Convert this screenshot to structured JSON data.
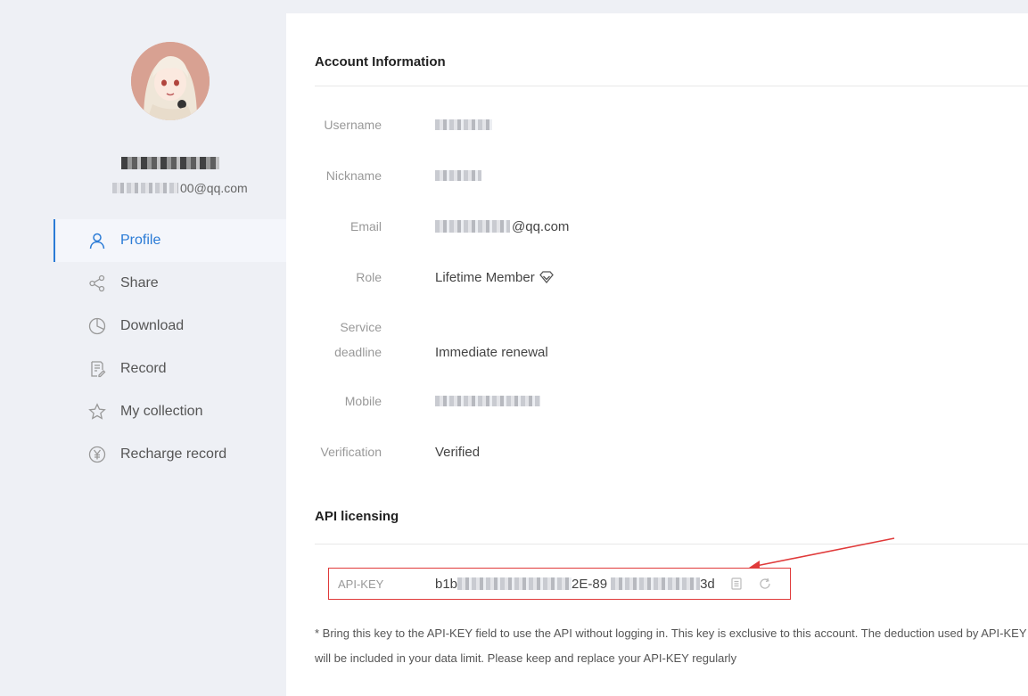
{
  "sidebar": {
    "user_email_suffix": "00@qq.com",
    "nav": [
      {
        "label": "Profile",
        "icon": "user-icon",
        "active": true
      },
      {
        "label": "Share",
        "icon": "share-icon"
      },
      {
        "label": "Download",
        "icon": "pie-chart-icon"
      },
      {
        "label": "Record",
        "icon": "record-icon"
      },
      {
        "label": "My collection",
        "icon": "star-icon"
      },
      {
        "label": "Recharge record",
        "icon": "yen-icon"
      }
    ]
  },
  "account": {
    "title": "Account Information",
    "fields": {
      "username_label": "Username",
      "nickname_label": "Nickname",
      "email_label": "Email",
      "email_suffix": "@qq.com",
      "role_label": "Role",
      "role_value": "Lifetime Member",
      "service_label_1": "Service",
      "service_label_2": "deadline",
      "service_value": "Immediate renewal",
      "mobile_label": "Mobile",
      "verification_label": "Verification",
      "verification_value": "Verified"
    }
  },
  "api": {
    "title": "API licensing",
    "key_label": "API-KEY",
    "key_prefix": "b1b",
    "key_mid": "2E-89",
    "key_suffix": "3d",
    "note": "* Bring this key to the API-KEY field to use the API without logging in. This key is exclusive to this account. The deduction used by API-KEY will be included in your data limit. Please keep and replace your API-KEY regularly"
  },
  "colors": {
    "accent": "#2a7bd6",
    "link": "#1e7bc7",
    "annotation": "#e03a3a"
  }
}
